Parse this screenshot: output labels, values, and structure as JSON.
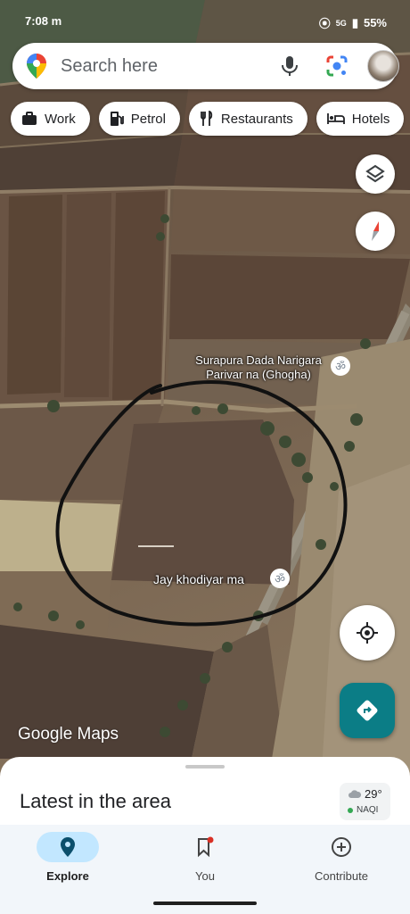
{
  "status_bar": {
    "time": "7:08",
    "carrier_marks": "m",
    "network": "5G",
    "battery": "55%"
  },
  "search": {
    "placeholder": "Search here",
    "icons": [
      "maps-pin-icon",
      "mic-icon",
      "google-lens-icon",
      "profile-avatar"
    ]
  },
  "chips": [
    {
      "label": "Work",
      "icon": "briefcase-icon"
    },
    {
      "label": "Petrol",
      "icon": "fuel-pump-icon"
    },
    {
      "label": "Restaurants",
      "icon": "fork-knife-icon"
    },
    {
      "label": "Hotels",
      "icon": "bed-icon"
    }
  ],
  "map": {
    "places": [
      {
        "name": "Surapura Dada Narigara\nParivar na (Ghogha)",
        "icon": "om-temple-icon"
      },
      {
        "name": "Jay khodiyar ma",
        "icon": "om-temple-icon"
      }
    ],
    "poi_glyph": "ॐ",
    "watermark": "Google Maps",
    "annotation": "hand-drawn black circle",
    "controls": [
      "layers-icon",
      "compass-icon",
      "my-location-icon",
      "directions-icon"
    ]
  },
  "sheet": {
    "title": "Latest in the area",
    "weather": {
      "temp": "29°",
      "air_quality": "NAQI",
      "aq_color": "#34a853"
    }
  },
  "nav": [
    {
      "label": "Explore",
      "icon": "explore-pin-icon",
      "active": true
    },
    {
      "label": "You",
      "icon": "bookmark-icon",
      "active": false,
      "badge": true
    },
    {
      "label": "Contribute",
      "icon": "add-circle-icon",
      "active": false
    }
  ],
  "colors": {
    "fab": "#0b7d86",
    "nav_active_pill": "#c2e7ff",
    "badge": "#d93025"
  }
}
